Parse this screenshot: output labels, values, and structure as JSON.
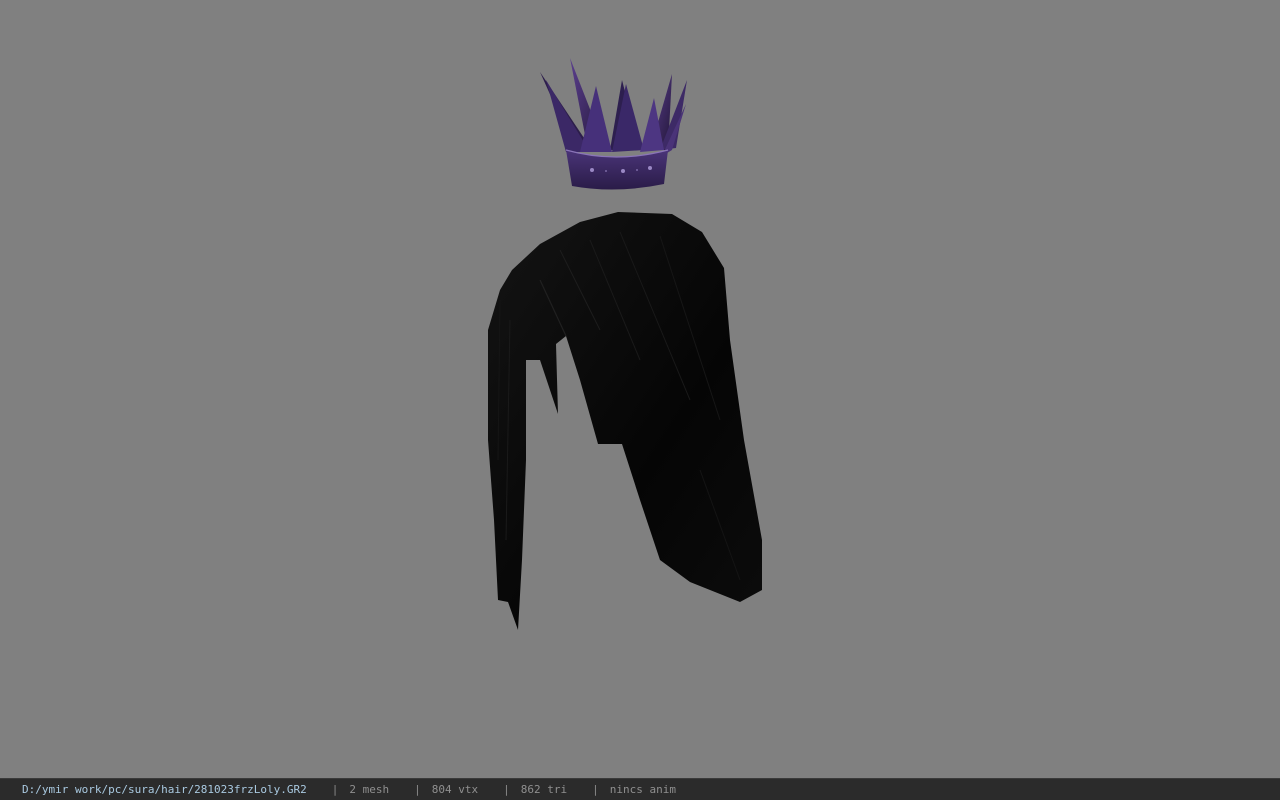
{
  "viewer": {
    "background_color": "#808080",
    "model_parts": [
      {
        "name": "crown",
        "color": "#3a2660"
      },
      {
        "name": "hair",
        "color": "#060606"
      }
    ]
  },
  "status_bar": {
    "file_path": "D:/ymir work/pc/sura/hair/281023frzLoly.GR2",
    "separator": "|",
    "mesh_count": "2 mesh",
    "vertex_count": "804 vtx",
    "triangle_count": "862 tri",
    "animation": "nincs anim"
  }
}
